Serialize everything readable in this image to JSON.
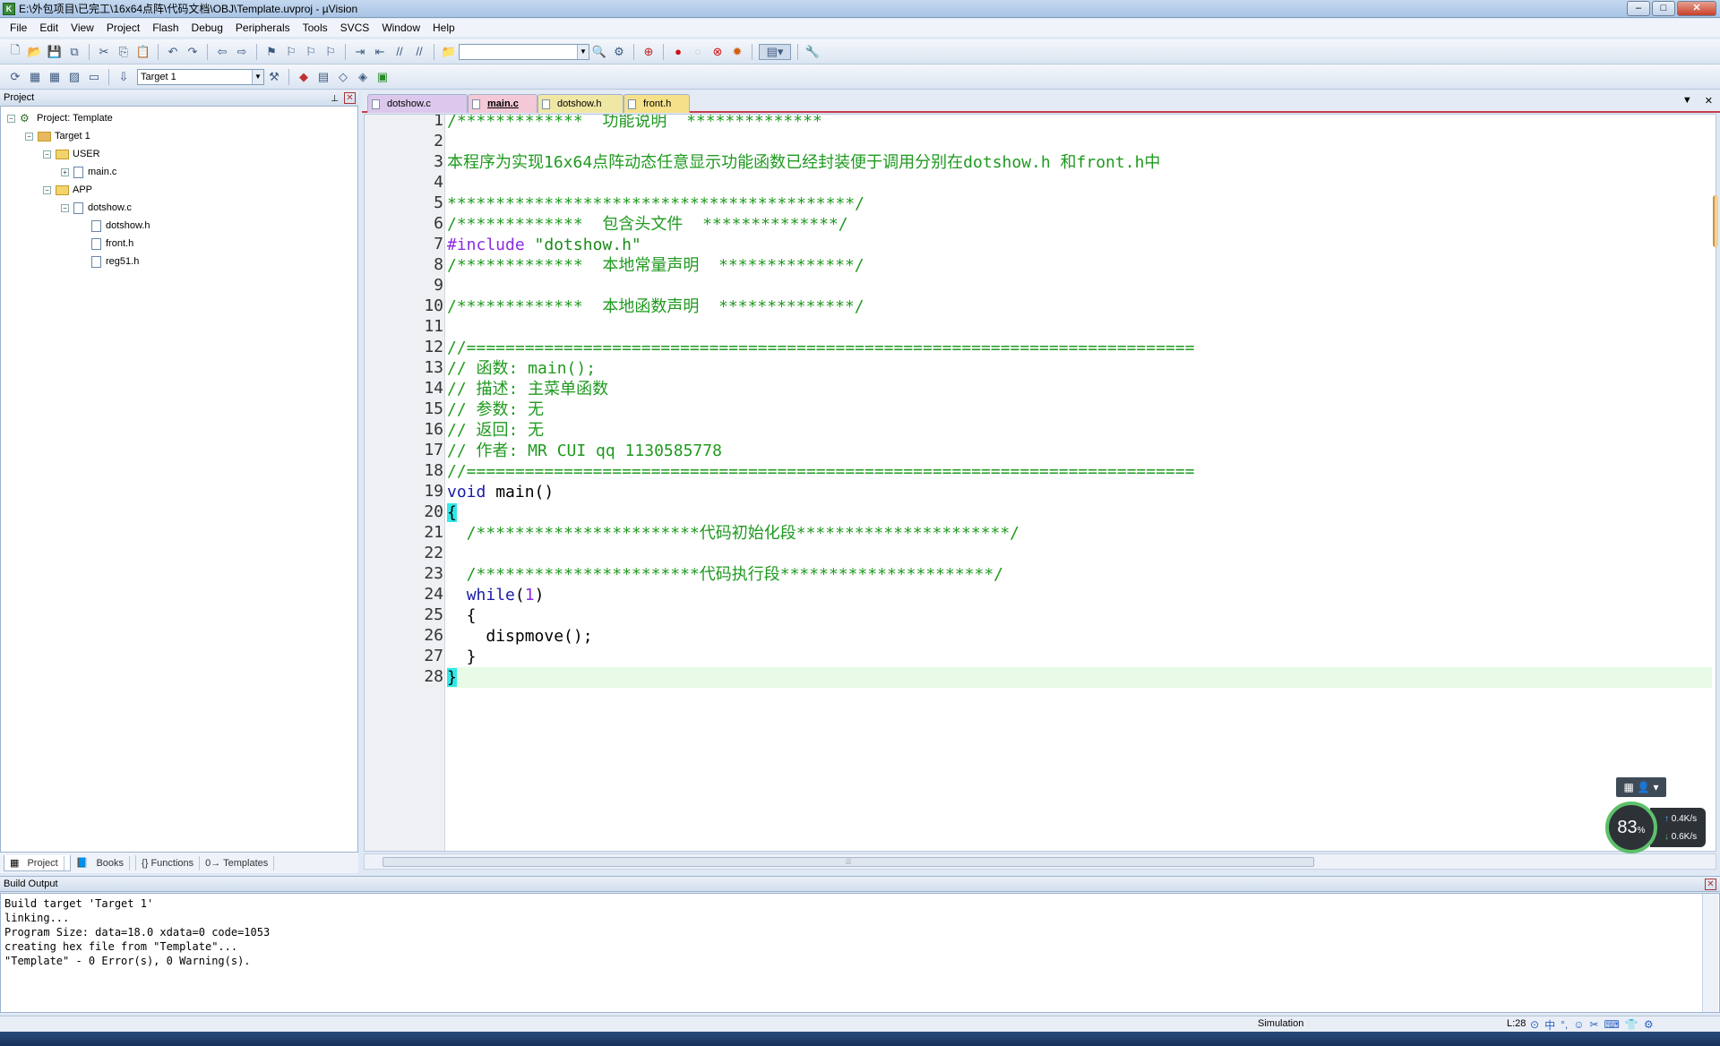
{
  "window": {
    "title": "E:\\外包项目\\已完工\\16x64点阵\\代码文档\\OBJ\\Template.uvproj - µVision",
    "app_icon": "keil-icon",
    "buttons": [
      "minimize",
      "maximize",
      "close"
    ]
  },
  "menu": [
    "File",
    "Edit",
    "View",
    "Project",
    "Flash",
    "Debug",
    "Peripherals",
    "Tools",
    "SVCS",
    "Window",
    "Help"
  ],
  "toolbar": {
    "target_select": "Target 1",
    "find_combo": ""
  },
  "project_panel": {
    "header": "Project",
    "tree": [
      {
        "label": "Project: Template",
        "level": 0,
        "kind": "project",
        "expander": "⊟"
      },
      {
        "label": "Target 1",
        "level": 1,
        "kind": "target",
        "expander": "⊟"
      },
      {
        "label": "USER",
        "level": 2,
        "kind": "folder",
        "expander": "⊟"
      },
      {
        "label": "main.c",
        "level": 3,
        "kind": "file",
        "expander": "⊞"
      },
      {
        "label": "APP",
        "level": 2,
        "kind": "folder",
        "expander": "⊟"
      },
      {
        "label": "dotshow.c",
        "level": 3,
        "kind": "file",
        "expander": "⊟"
      },
      {
        "label": "dotshow.h",
        "level": 4,
        "kind": "file",
        "expander": ""
      },
      {
        "label": "front.h",
        "level": 4,
        "kind": "file",
        "expander": ""
      },
      {
        "label": "reg51.h",
        "level": 4,
        "kind": "file",
        "expander": ""
      }
    ],
    "tabs": [
      "Project",
      "Books",
      "{} Functions",
      "0→ Templates"
    ]
  },
  "editor": {
    "tabs": [
      "dotshow.c",
      "main.c",
      "dotshow.h",
      "front.h"
    ],
    "active_tab": "main.c",
    "current_line": 28,
    "lines": [
      {
        "n": "1",
        "segs": [
          {
            "t": "/*************  功能说明  **************",
            "c": "green"
          }
        ]
      },
      {
        "n": "2",
        "segs": []
      },
      {
        "n": "3",
        "segs": [
          {
            "t": "本程序为实现16x64点阵动态任意显示功能函数已经封装便于调用分别在dotshow.h 和front.h中",
            "c": "green"
          }
        ]
      },
      {
        "n": "4",
        "segs": []
      },
      {
        "n": "5",
        "segs": [
          {
            "t": "******************************************/",
            "c": "green"
          }
        ]
      },
      {
        "n": "6",
        "segs": [
          {
            "t": "/*************  包含头文件  **************/",
            "c": "green"
          }
        ]
      },
      {
        "n": "7",
        "segs": [
          {
            "t": "#include ",
            "c": "purple"
          },
          {
            "t": "\"dotshow.h\"",
            "c": "sgreen"
          }
        ]
      },
      {
        "n": "8",
        "segs": [
          {
            "t": "/*************  本地常量声明  **************/",
            "c": "green"
          }
        ]
      },
      {
        "n": "9",
        "segs": []
      },
      {
        "n": "10",
        "segs": [
          {
            "t": "/*************  本地函数声明  **************/",
            "c": "green"
          }
        ]
      },
      {
        "n": "11",
        "segs": []
      },
      {
        "n": "12",
        "segs": [
          {
            "t": "//===========================================================================",
            "c": "green"
          }
        ]
      },
      {
        "n": "13",
        "segs": [
          {
            "t": "// 函数: main();",
            "c": "green"
          }
        ]
      },
      {
        "n": "14",
        "segs": [
          {
            "t": "// 描述: 主菜单函数",
            "c": "green"
          }
        ]
      },
      {
        "n": "15",
        "segs": [
          {
            "t": "// 参数: 无",
            "c": "green"
          }
        ]
      },
      {
        "n": "16",
        "segs": [
          {
            "t": "// 返回: 无",
            "c": "green"
          }
        ]
      },
      {
        "n": "17",
        "segs": [
          {
            "t": "// 作者: MR CUI qq 1130585778",
            "c": "green"
          }
        ]
      },
      {
        "n": "18",
        "segs": [
          {
            "t": "//===========================================================================",
            "c": "green"
          }
        ]
      },
      {
        "n": "19",
        "segs": [
          {
            "t": "void",
            "c": "dblue"
          },
          {
            "t": " main()",
            "c": ""
          }
        ]
      },
      {
        "n": "20",
        "segs": [
          {
            "t": "{",
            "c": "brace-hl"
          }
        ]
      },
      {
        "n": "21",
        "segs": [
          {
            "t": "  /***********************代码初始化段**********************/",
            "c": "green"
          }
        ]
      },
      {
        "n": "22",
        "segs": []
      },
      {
        "n": "23",
        "segs": [
          {
            "t": "  /***********************代码执行段**********************/",
            "c": "green"
          }
        ]
      },
      {
        "n": "24",
        "segs": [
          {
            "t": "  ",
            "c": ""
          },
          {
            "t": "while",
            "c": "dblue"
          },
          {
            "t": "(",
            "c": ""
          },
          {
            "t": "1",
            "c": "purple"
          },
          {
            "t": ")",
            "c": ""
          }
        ]
      },
      {
        "n": "25",
        "segs": [
          {
            "t": "  {",
            "c": ""
          }
        ]
      },
      {
        "n": "26",
        "segs": [
          {
            "t": "    dispmove();",
            "c": ""
          }
        ]
      },
      {
        "n": "27",
        "segs": [
          {
            "t": "  }",
            "c": ""
          }
        ]
      },
      {
        "n": "28",
        "segs": [
          {
            "t": "}",
            "c": "brace-hl"
          }
        ]
      }
    ]
  },
  "build_output": {
    "header": "Build Output",
    "lines": [
      "Build target 'Target 1'",
      "linking...",
      "Program Size: data=18.0 xdata=0 code=1053",
      "creating hex file from \"Template\"...",
      "\"Template\" - 0 Error(s), 0 Warning(s)."
    ]
  },
  "status": {
    "mode": "Simulation",
    "line": "L:28"
  },
  "net_widget": {
    "percent": "83",
    "percent_unit": "%",
    "up": "0.4K/s",
    "down": "0.6K/s"
  },
  "ime_icons": [
    "中",
    "°,",
    "☺",
    "✂",
    "⌨",
    "👕",
    "⚙"
  ]
}
